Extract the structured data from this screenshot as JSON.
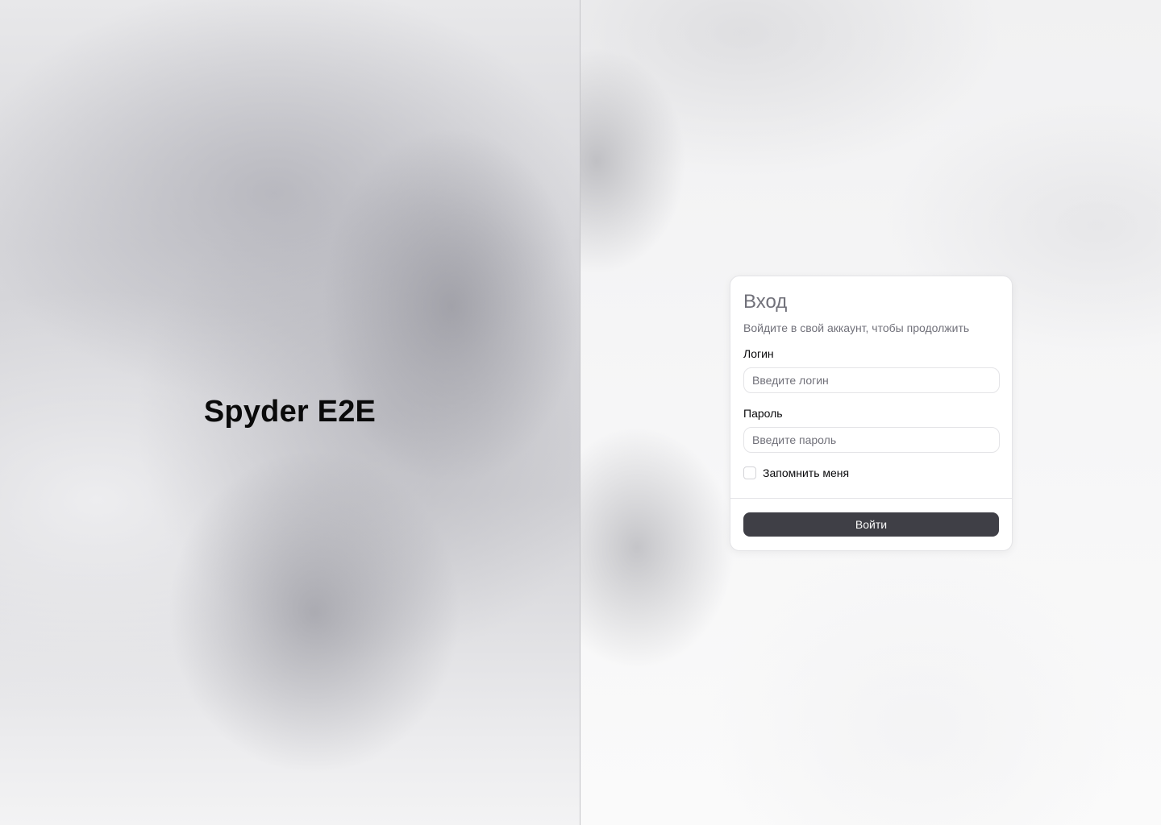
{
  "brand": {
    "title": "Spyder E2E"
  },
  "login": {
    "title": "Вход",
    "subtitle": "Войдите в свой аккаунт, чтобы продолжить",
    "username": {
      "label": "Логин",
      "placeholder": "Введите логин",
      "value": ""
    },
    "password": {
      "label": "Пароль",
      "placeholder": "Введите пароль",
      "value": ""
    },
    "remember": {
      "label": "Запомнить меня",
      "checked": false
    },
    "submit_label": "Войти"
  },
  "colors": {
    "primary_button": "#3f3f46",
    "text": "#09090b",
    "muted_text": "#71717a",
    "border": "#e4e4e7"
  }
}
